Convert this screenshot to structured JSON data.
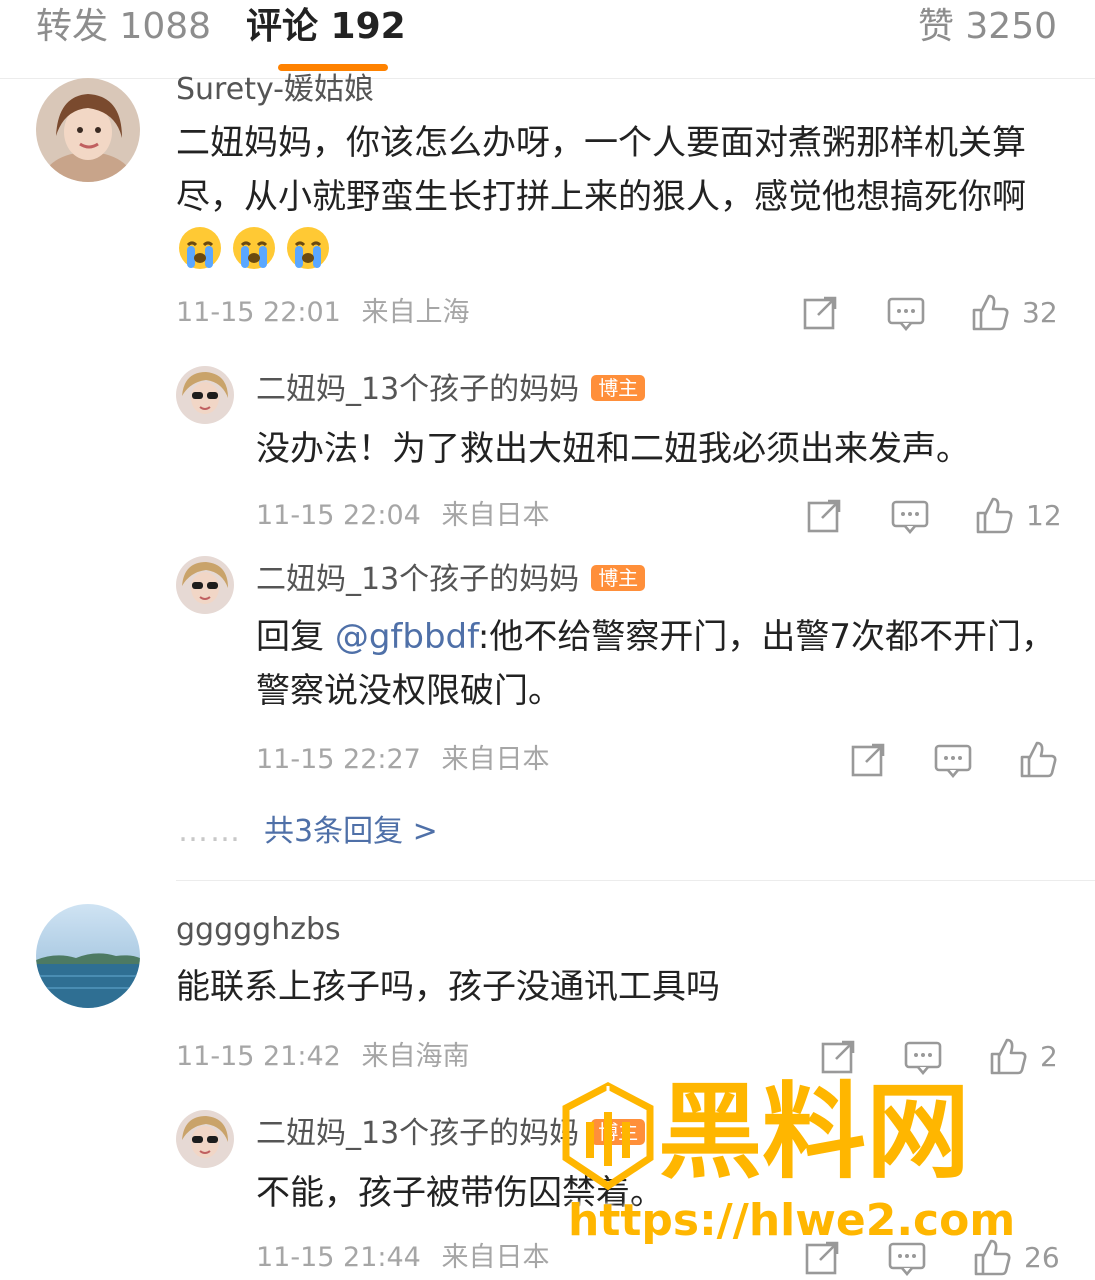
{
  "tabs": {
    "repost": "转发 1088",
    "comments": "评论 192",
    "likes": "赞 3250"
  },
  "comments": [
    {
      "username": "Surety-媛姑娘",
      "text": "二妞妈妈，你该怎么办呀，一个人要面对煮粥那样机关算尽，从小就野蛮生长打拼上来的狠人，感觉他想搞死你啊",
      "emoji": [
        "crying-face",
        "crying-face",
        "crying-face"
      ],
      "time": "11-15 22:01",
      "location": "来自上海",
      "likes": "32"
    },
    {
      "username": "二妞妈_13个孩子的妈妈",
      "badge": "博主",
      "text": "没办法！为了救出大妞和二妞我必须出来发声。",
      "time": "11-15 22:04",
      "location": "来自日本",
      "likes": "12"
    },
    {
      "username": "二妞妈_13个孩子的妈妈",
      "badge": "博主",
      "reply_prefix": "回复 ",
      "mention": "@gfbbdf",
      "text": ":他不给警察开门，出警7次都不开门，警察说没权限破门。",
      "time": "11-15 22:27",
      "location": "来自日本",
      "likes": ""
    },
    {
      "username": "ggggghzbs",
      "text": "能联系上孩子吗，孩子没通讯工具吗",
      "time": "11-15 21:42",
      "location": "来自海南",
      "likes": "2"
    },
    {
      "username": "二妞妈_13个孩子的妈妈",
      "badge": "博主",
      "text": "不能，孩子被带伤囚禁着。",
      "time": "11-15 21:44",
      "location": "来自日本",
      "likes": "26"
    }
  ],
  "more_replies": {
    "dots": "……",
    "label": "共3条回复 >"
  },
  "watermark": {
    "title": "黑料网",
    "url": "https://hlwe2.com"
  },
  "colors": {
    "accent": "#ff8200",
    "link": "#4f70a8",
    "badge": "#ff8f3a",
    "watermark": "#ffb600"
  }
}
